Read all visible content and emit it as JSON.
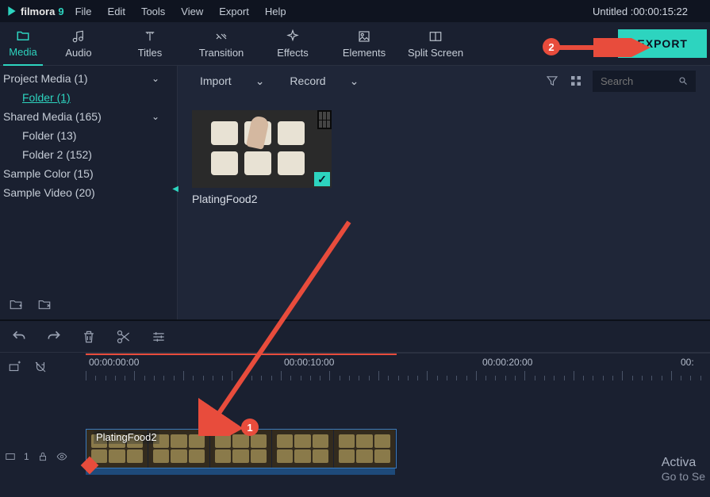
{
  "app": {
    "name": "filmora",
    "version": "9"
  },
  "menu": [
    "File",
    "Edit",
    "Tools",
    "View",
    "Export",
    "Help"
  ],
  "project_title": "Untitled :00:00:15:22",
  "tabs": [
    {
      "label": "Media",
      "active": true
    },
    {
      "label": "Audio"
    },
    {
      "label": "Titles"
    },
    {
      "label": "Transition"
    },
    {
      "label": "Effects"
    },
    {
      "label": "Elements"
    },
    {
      "label": "Split Screen"
    }
  ],
  "export_label": "EXPORT",
  "sidebar": {
    "items": [
      {
        "label": "Project Media (1)",
        "type": "root",
        "expandable": true
      },
      {
        "label": "Folder (1)",
        "type": "child",
        "link": true
      },
      {
        "label": "Shared Media (165)",
        "type": "root",
        "expandable": true
      },
      {
        "label": "Folder (13)",
        "type": "child"
      },
      {
        "label": "Folder 2 (152)",
        "type": "child"
      },
      {
        "label": "Sample Color (15)",
        "type": "root"
      },
      {
        "label": "Sample Video (20)",
        "type": "root"
      }
    ]
  },
  "content_bar": {
    "import": "Import",
    "record": "Record",
    "search_placeholder": "Search"
  },
  "thumbnail": {
    "label": "PlatingFood2"
  },
  "timeline": {
    "timecodes": [
      "00:00:00:00",
      "00:00:10:00",
      "00:00:20:00",
      "00:"
    ],
    "clip_label": "PlatingFood2",
    "track_index": "1"
  },
  "annotations": {
    "badge1": "1",
    "badge2": "2"
  },
  "watermark": {
    "line1": "Activa",
    "line2": "Go to Se"
  }
}
